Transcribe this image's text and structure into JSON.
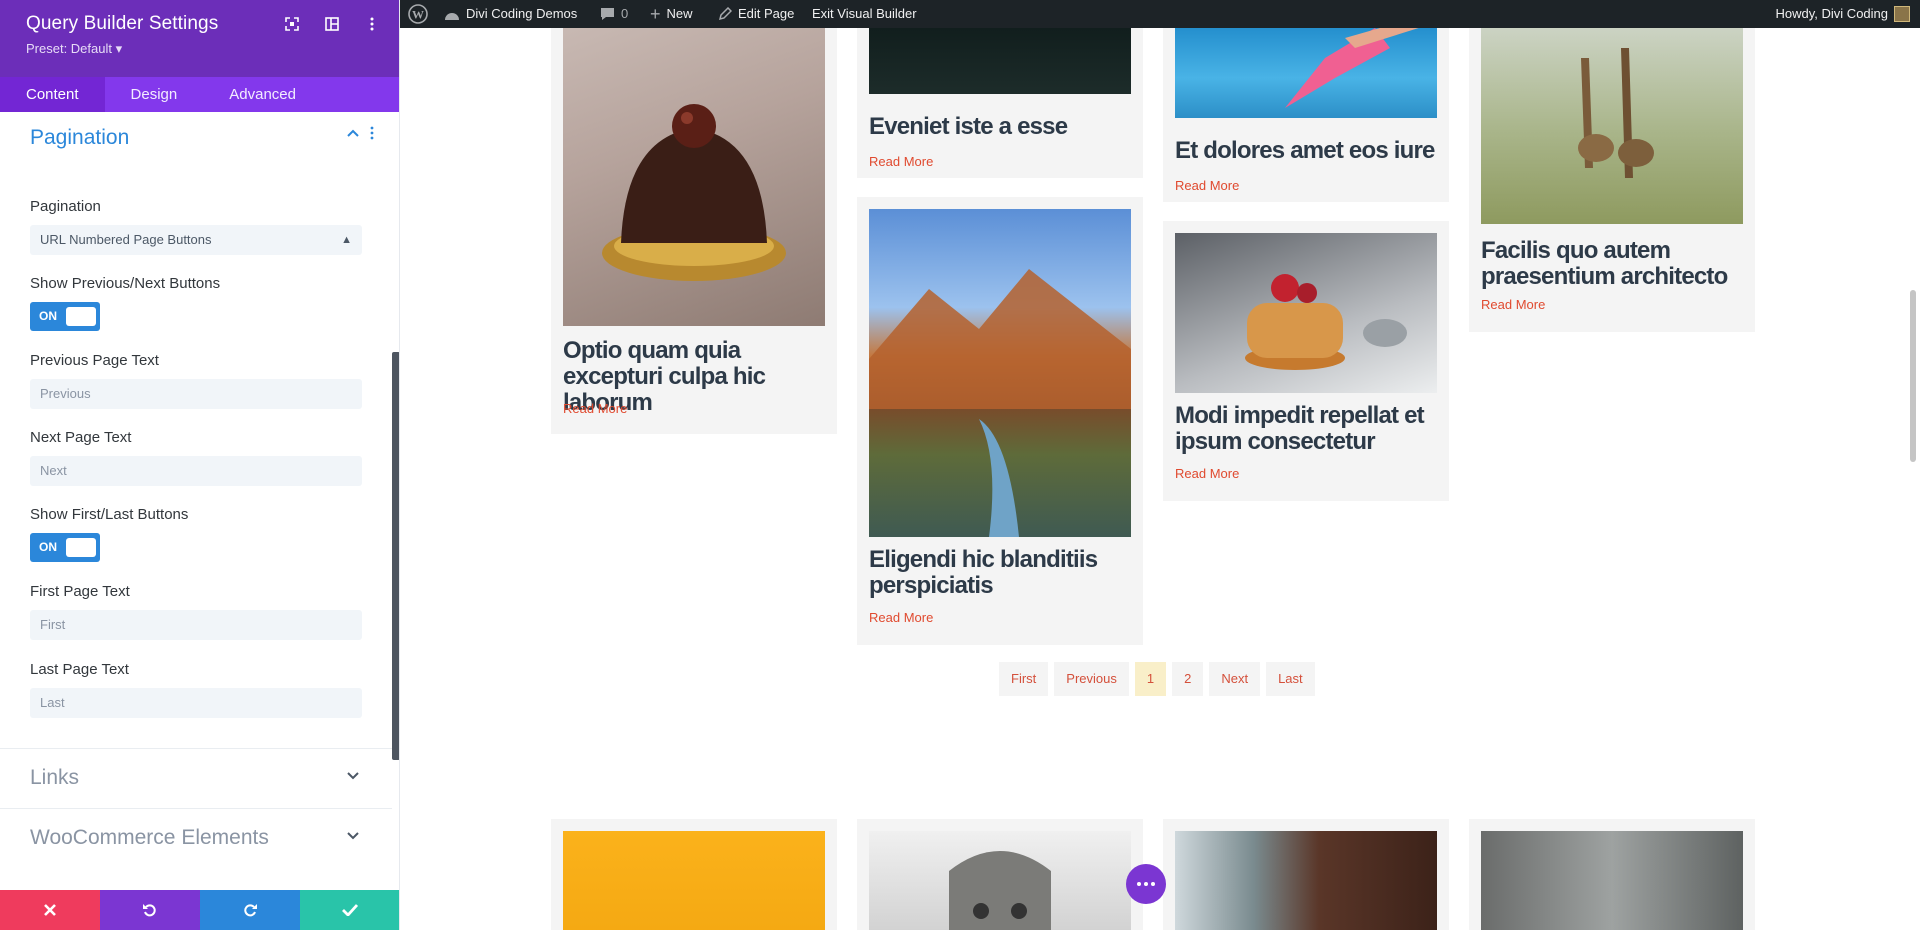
{
  "panel": {
    "title": "Query Builder Settings",
    "preset": "Preset: Default ▾",
    "tabs": [
      {
        "label": "Content"
      },
      {
        "label": "Design"
      },
      {
        "label": "Advanced"
      }
    ],
    "active_tab": "Content"
  },
  "pagination_section": {
    "title": "Pagination",
    "pagination_label": "Pagination",
    "pagination_value": "URL Numbered Page Buttons",
    "show_prev_next_label": "Show Previous/Next Buttons",
    "show_prev_next_toggle": "ON",
    "prev_text_label": "Previous Page Text",
    "prev_text_placeholder": "Previous",
    "next_text_label": "Next Page Text",
    "next_text_placeholder": "Next",
    "show_first_last_label": "Show First/Last Buttons",
    "show_first_last_toggle": "ON",
    "first_text_label": "First Page Text",
    "first_text_placeholder": "First",
    "last_text_label": "Last Page Text",
    "last_text_placeholder": "Last"
  },
  "collapsed_sections": [
    {
      "title": "Links"
    },
    {
      "title": "WooCommerce Elements"
    }
  ],
  "adminbar": {
    "site_name": "Divi Coding Demos",
    "comments_count": "0",
    "new_label": "New",
    "edit_page_label": "Edit Page",
    "exit_vb_label": "Exit Visual Builder",
    "howdy": "Howdy, Divi Coding"
  },
  "posts": [
    {
      "title": "Optio quam quia excepturi culpa hic laborum",
      "read_more": "Read More",
      "image": "chocolate-dessert"
    },
    {
      "title": "Eveniet iste a esse",
      "read_more": "Read More",
      "image": "dark-forest"
    },
    {
      "title": "Eligendi hic blanditiis perspiciatis",
      "read_more": "Read More",
      "image": "canyon-river"
    },
    {
      "title": "Et dolores amet eos iure",
      "read_more": "Read More",
      "image": "pool-pink-heel"
    },
    {
      "title": "Modi impedit repellat et ipsum consectetur",
      "read_more": "Read More",
      "image": "pancakes"
    },
    {
      "title": "Facilis quo autem praesentium architecto",
      "read_more": "Read More",
      "image": "giraffes"
    }
  ],
  "pager": {
    "first": "First",
    "previous": "Previous",
    "pages": [
      "1",
      "2"
    ],
    "current": "1",
    "next": "Next",
    "last": "Last"
  },
  "bottom_images": [
    "yellow-dessert",
    "owl",
    "waterfall",
    "grey-trees"
  ],
  "colors": {
    "accent_purple": "#6c2eb9",
    "tab_purple": "#8338ec",
    "toggle_blue": "#2b87da",
    "read_more": "#e04a2f",
    "cancel": "#ef3b5d",
    "save": "#29c4a9"
  }
}
